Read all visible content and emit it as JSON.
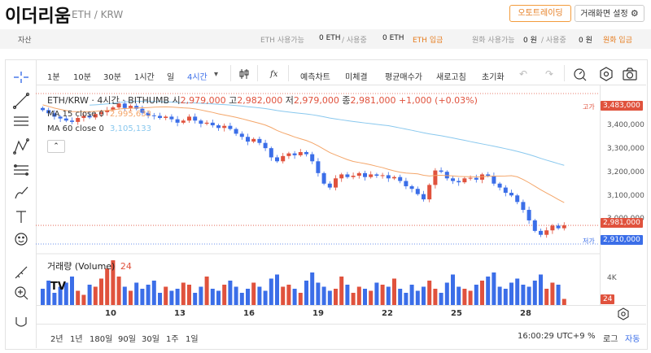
{
  "header": {
    "title": "이더리움",
    "pair": "ETH / KRW",
    "auto_trade_label": "오토트레이딩",
    "settings_label": "거래화면 설정"
  },
  "assets": {
    "label": "자산",
    "eth_available_label": "ETH 사용가능",
    "eth_available": "0 ETH",
    "eth_in_use_label": "/ 사용중",
    "eth_in_use": "0 ETH",
    "eth_deposit": "ETH 입금",
    "krw_available_label": "원화 사용가능",
    "krw_available": "0 원",
    "krw_in_use_label": "/ 사용중",
    "krw_in_use": "0 원",
    "krw_deposit": "원화 입금"
  },
  "toolbar": {
    "intervals": [
      "1분",
      "10분",
      "30분",
      "1시간",
      "일",
      "4시간"
    ],
    "active_interval": "4시간",
    "fx_label": "fx",
    "buttons": [
      "예측차트",
      "미체결",
      "평균매수가",
      "새로고침",
      "초기화"
    ]
  },
  "legend": {
    "symbol": "ETH/KRW · 4시간 · BITHUMB",
    "open_label": "시",
    "open": "2,979,000",
    "high_label": "고",
    "high": "2,982,000",
    "low_label": "저",
    "low": "2,979,000",
    "close_label": "종",
    "close": "2,981,000",
    "change": "+1,000 (+0.03%)",
    "ma15_label": "MA 15 close 0",
    "ma15_value": "2,995,633",
    "ma60_label": "MA 60 close 0",
    "ma60_value": "3,105,133"
  },
  "volume_legend": {
    "label": "거래량 (Volume)",
    "value": "24"
  },
  "axis": {
    "price_ticks": [
      "3,400,000",
      "3,300,000",
      "3,200,000",
      "3,100,000",
      "3,000,000"
    ],
    "high_tag": "고가",
    "high_value": "3,483,000",
    "low_tag": "저가",
    "low_value": "2,910,000",
    "current_value": "2,981,000",
    "volume_tick": "4K",
    "volume_value": "24",
    "date_ticks": [
      "10",
      "13",
      "16",
      "19",
      "22",
      "25",
      "28"
    ]
  },
  "ranges": [
    "2년",
    "1년",
    "180일",
    "90일",
    "30일",
    "1주",
    "1일"
  ],
  "footer": {
    "time": "16:00:29 UTC+9",
    "percent": "%",
    "log": "로그",
    "auto": "자동"
  },
  "colors": {
    "up": "#e0523d",
    "down": "#3b6ee8",
    "accent": "#e67e22",
    "ma15": "#f4a66a",
    "ma60": "#89c8ee"
  },
  "chart_data": {
    "type": "candlestick",
    "x_ticks": [
      "10",
      "13",
      "16",
      "19",
      "22",
      "25",
      "28"
    ],
    "ylim": [
      2910000,
      3483000
    ],
    "closes": [
      3420000,
      3408000,
      3395000,
      3388000,
      3380000,
      3375000,
      3390000,
      3398000,
      3392000,
      3405000,
      3412000,
      3420000,
      3430000,
      3445000,
      3428000,
      3436000,
      3425000,
      3410000,
      3400000,
      3398000,
      3390000,
      3395000,
      3385000,
      3372000,
      3380000,
      3395000,
      3380000,
      3368000,
      3372000,
      3362000,
      3352000,
      3360000,
      3348000,
      3330000,
      3318000,
      3300000,
      3310000,
      3295000,
      3275000,
      3240000,
      3225000,
      3245000,
      3255000,
      3248000,
      3260000,
      3252000,
      3225000,
      3180000,
      3140000,
      3125000,
      3160000,
      3175000,
      3165000,
      3170000,
      3180000,
      3165000,
      3175000,
      3170000,
      3172000,
      3160000,
      3165000,
      3150000,
      3130000,
      3120000,
      3100000,
      3080000,
      3135000,
      3190000,
      3185000,
      3160000,
      3150000,
      3145000,
      3160000,
      3162000,
      3155000,
      3175000,
      3170000,
      3140000,
      3125000,
      3105000,
      3095000,
      3070000,
      3040000,
      3000000,
      2960000,
      2945000,
      2962000,
      2980000,
      2970000,
      2981000
    ],
    "volume": [
      8,
      12,
      6,
      9,
      11,
      14,
      7,
      5,
      10,
      9,
      13,
      18,
      22,
      14,
      9,
      7,
      11,
      8,
      10,
      12,
      6,
      9,
      7,
      8,
      11,
      10,
      6,
      9,
      14,
      8,
      7,
      10,
      12,
      9,
      6,
      8,
      11,
      9,
      7,
      13,
      15,
      9,
      10,
      8,
      6,
      12,
      16,
      11,
      9,
      7,
      8,
      14,
      10,
      6,
      9,
      8,
      7,
      11,
      10,
      9,
      13,
      8,
      6,
      10,
      7,
      9,
      12,
      8,
      6,
      11,
      15,
      9,
      8,
      7,
      10,
      12,
      14,
      16,
      9,
      8,
      11,
      13,
      10,
      9,
      12,
      15,
      8,
      11,
      10,
      3
    ]
  }
}
